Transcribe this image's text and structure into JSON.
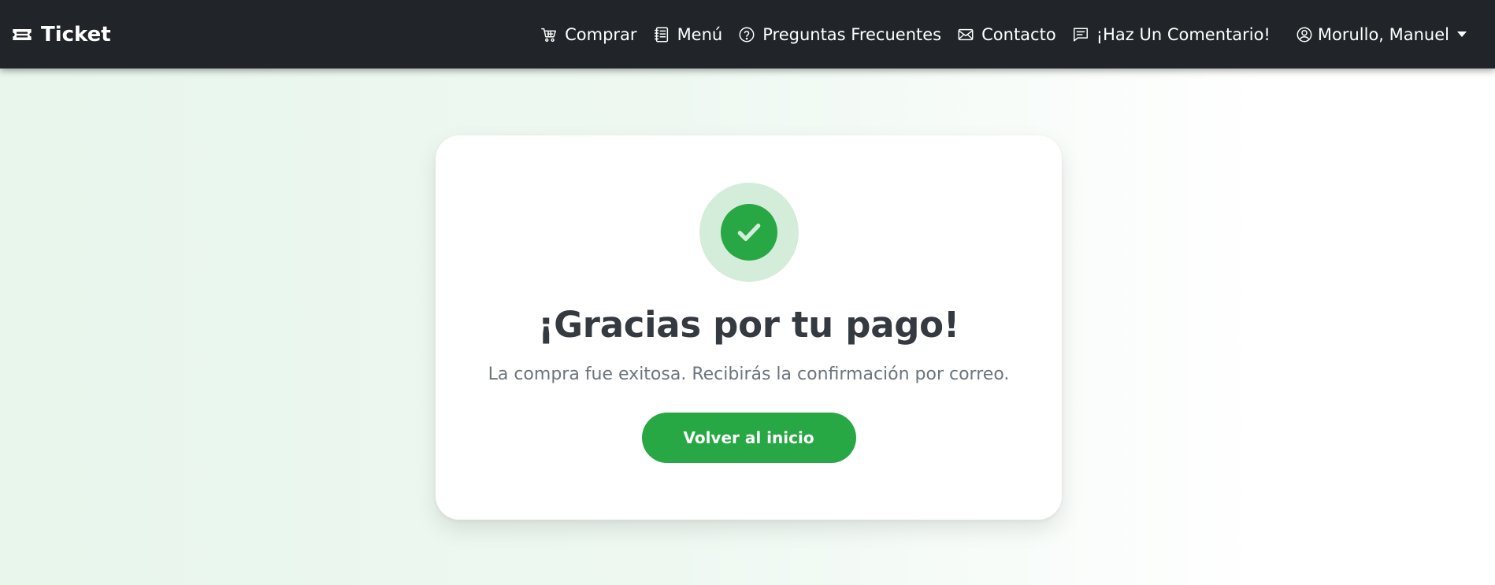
{
  "navbar": {
    "brand": {
      "label": "Ticket",
      "icon": "ticket-icon"
    },
    "links": [
      {
        "label": "Comprar",
        "icon": "cart-icon"
      },
      {
        "label": "Menú",
        "icon": "menu-book-icon"
      },
      {
        "label": "Preguntas Frecuentes",
        "icon": "question-circle-icon"
      },
      {
        "label": "Contacto",
        "icon": "envelope-icon"
      },
      {
        "label": "¡Haz Un Comentario!",
        "icon": "chat-icon"
      }
    ],
    "user": {
      "label": "Morullo, Manuel",
      "icon": "user-circle-icon"
    }
  },
  "card": {
    "icon": "check-icon",
    "title": "¡Gracias por tu pago!",
    "message": "La compra fue exitosa. Recibirás la confirmación por correo.",
    "button_label": "Volver al inicio"
  },
  "colors": {
    "navbar": "#212529",
    "success": "#28a745",
    "success_light": "#d4edda",
    "title": "#343a40",
    "muted": "#6c757d"
  }
}
